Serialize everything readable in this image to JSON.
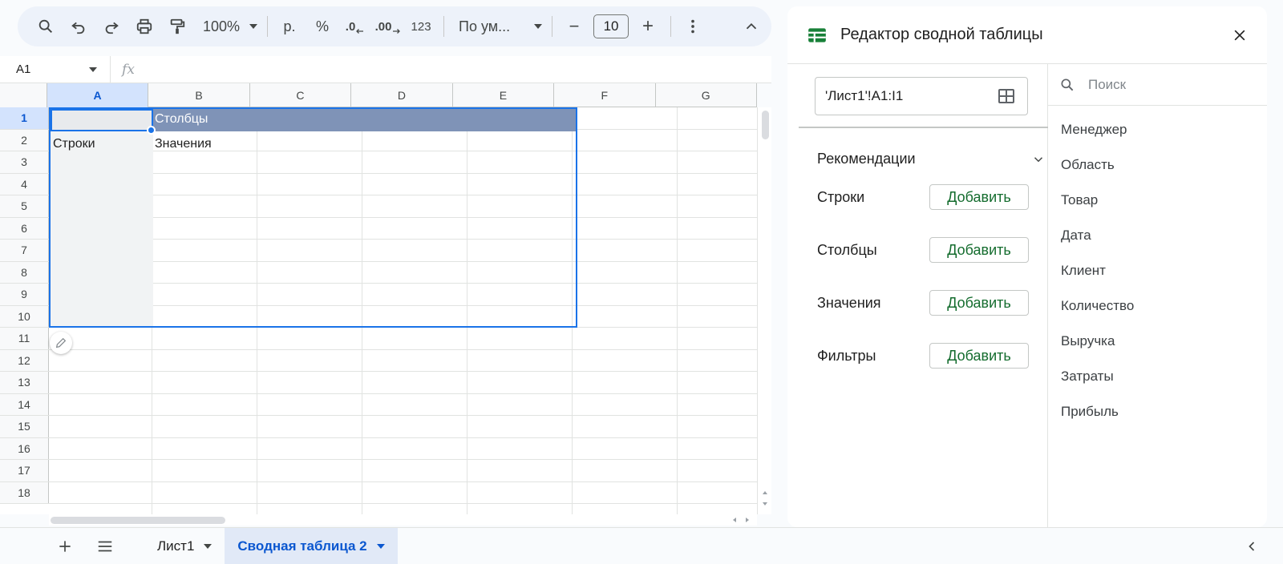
{
  "toolbar": {
    "zoom": "100%",
    "currency": "р.",
    "percent": "%",
    "dec_decrease": ".0",
    "dec_increase": ".00",
    "format_number": "123",
    "font": "По ум...",
    "font_size": "10",
    "minus": "−",
    "plus": "+"
  },
  "formula_bar": {
    "cell_ref": "A1",
    "fx_label": "fx"
  },
  "grid": {
    "columns": [
      "A",
      "B",
      "C",
      "D",
      "E",
      "F",
      "G"
    ],
    "rows": [
      "1",
      "2",
      "3",
      "4",
      "5",
      "6",
      "7",
      "8",
      "9",
      "10",
      "11",
      "12",
      "13",
      "14",
      "15",
      "16",
      "17",
      "18"
    ],
    "cells": {
      "B1": "Столбцы",
      "A2": "Строки",
      "B2": "Значения"
    }
  },
  "sheets": {
    "tabs": [
      {
        "label": "Лист1",
        "active": false
      },
      {
        "label": "Сводная таблица 2",
        "active": true
      }
    ]
  },
  "pivot_editor": {
    "title": "Редактор сводной таблицы",
    "range": "'Лист1'!A1:I1",
    "recommendations_label": "Рекомендации",
    "sections": [
      {
        "label": "Строки",
        "button": "Добавить"
      },
      {
        "label": "Столбцы",
        "button": "Добавить"
      },
      {
        "label": "Значения",
        "button": "Добавить"
      },
      {
        "label": "Фильтры",
        "button": "Добавить"
      }
    ],
    "search_placeholder": "Поиск",
    "fields": [
      "Менеджер",
      "Область",
      "Товар",
      "Дата",
      "Клиент",
      "Количество",
      "Выручка",
      "Затраты",
      "Прибыль"
    ]
  },
  "colors": {
    "accent": "#1a73e8",
    "pivot_header": "#7f93b7",
    "add_green": "#146c2e",
    "sheets_green": "#188038"
  }
}
